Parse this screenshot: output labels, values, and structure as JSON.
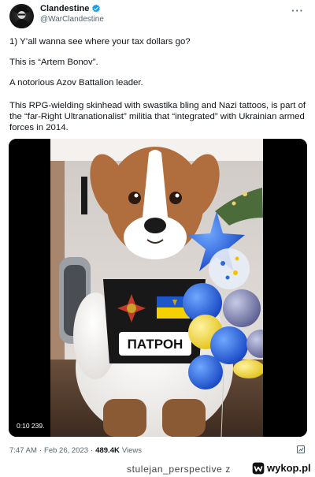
{
  "tweet": {
    "display_name": "Clandestine",
    "handle": "@WarClandestine",
    "more_icon": "more-horizontal-icon",
    "verified_color": "#1d9bf0",
    "paragraphs": [
      "1) Y’all wanna see where your tax dollars go?",
      "This is “Artem Bonov”.",
      "A notorious Azov Battalion leader.",
      "This RPG-wielding skinhead with swastika bling and Nazi tattoos, is part of the “far-Right Ultranationalist” militia that “integrated” with Ukrainian armed forces in 2014."
    ],
    "media": {
      "badge_text": "0:10  239.",
      "vest_text": "ПАТРОН"
    },
    "time": "7:47 AM",
    "separator": "·",
    "date": "Feb 26, 2023",
    "views_count": "489.4K",
    "views_label": "Views"
  },
  "watermark": {
    "credit": "stulejan_perspective  z",
    "site": "wykop.pl"
  }
}
